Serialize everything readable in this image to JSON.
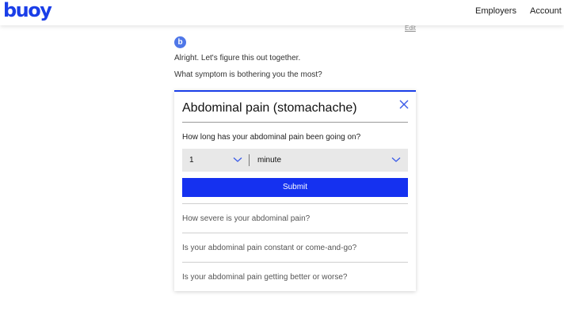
{
  "header": {
    "logo_text": "buoy",
    "nav": [
      "Employers",
      "Account"
    ]
  },
  "chat": {
    "edit_label": "Edit",
    "avatar_letter": "b",
    "messages": [
      "Alright. Let's figure this out together.",
      "What symptom is bothering you the most?"
    ]
  },
  "card": {
    "title": "Abdominal pain (stomachache)",
    "question": "How long has your abdominal pain been going on?",
    "duration_value": "1",
    "duration_unit": "minute",
    "submit_label": "Submit",
    "upcoming_questions": [
      "How severe is your abdominal pain?",
      "Is your abdominal pain constant or come-and-go?",
      "Is your abdominal pain getting better or worse?"
    ]
  },
  "colors": {
    "brand": "#1a3ee8",
    "submit": "#1531f0",
    "select_bg": "#e8e8e8"
  },
  "icons": [
    "close-icon",
    "chevron-down-icon"
  ]
}
